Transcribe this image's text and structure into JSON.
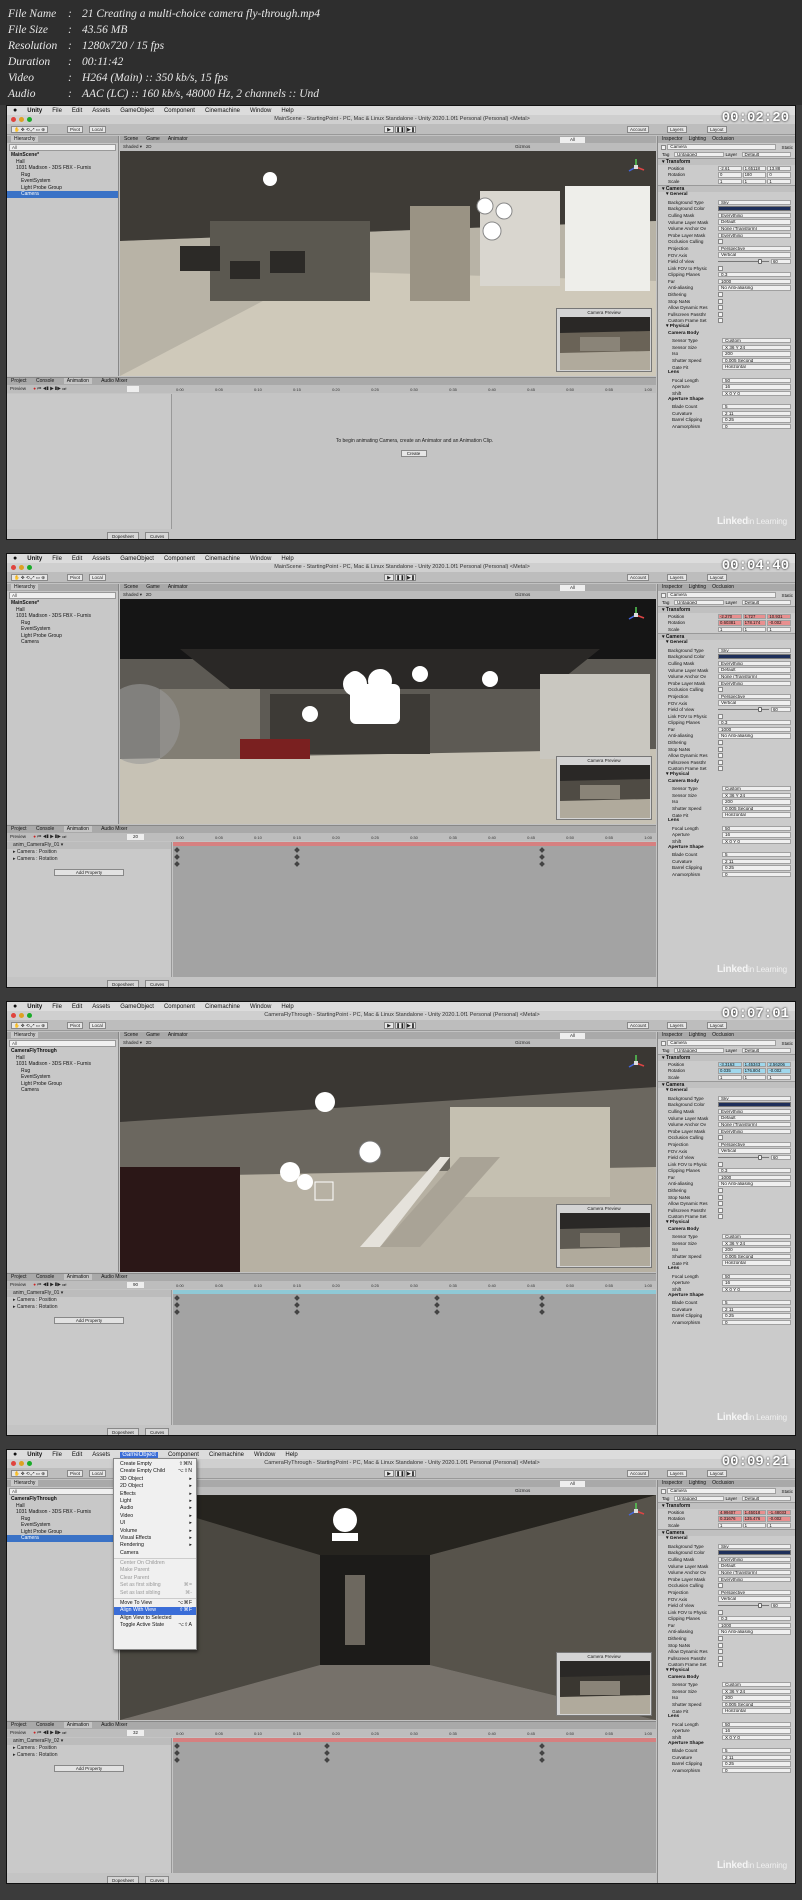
{
  "header": {
    "rows": [
      {
        "key": "File Name",
        "value": "21 Creating a multi-choice camera fly-through.mp4"
      },
      {
        "key": "File Size",
        "value": "43.56 MB"
      },
      {
        "key": "Resolution",
        "value": "1280x720 / 15 fps"
      },
      {
        "key": "Duration",
        "value": "00:11:42"
      },
      {
        "key": "Video",
        "value": "H264 (Main) :: 350 kb/s, 15 fps"
      },
      {
        "key": "Audio",
        "value": "AAC (LC) :: 160 kb/s, 48000 Hz, 2 channels :: Und"
      }
    ]
  },
  "common": {
    "menu": [
      "Unity",
      "File",
      "Edit",
      "Assets",
      "GameObject",
      "Component",
      "Cinemachine",
      "Window",
      "Help"
    ],
    "toolbar": {
      "pivot": "Pivot",
      "local": "Local",
      "collab": "Collab",
      "account": "Account",
      "layers": "Layers",
      "layout": "Layout"
    },
    "panels": {
      "hierarchy": "Hierarchy",
      "scene": "Scene",
      "game": "Game",
      "animator": "Animator",
      "inspector": "Inspector",
      "lighting": "Lighting",
      "occlusion": "Occlusion",
      "project": "Project",
      "console": "Console",
      "animation": "Animation",
      "audio_mixer": "Audio Mixer",
      "camera_preview": "Camera Preview"
    },
    "scene_toolbar": {
      "shading": "Shaded",
      "mode": "2D",
      "gizmos": "Gizmos",
      "search": "All"
    },
    "anim_toolbar": {
      "preview": "Preview",
      "add_property": "Add Property",
      "dopesheet": "Dopesheet",
      "curves": "Curves"
    },
    "inspector": {
      "object": "Camera",
      "static": "Static",
      "tag_label": "Tag",
      "tag": "Untagged",
      "layer_label": "Layer",
      "layer": "Default",
      "transform": "Transform",
      "position": "Position",
      "rotation": "Rotation",
      "scale": "Scale",
      "camera": "Camera",
      "general": "General",
      "rows": [
        {
          "label": "Background Type",
          "value": "Sky"
        },
        {
          "label": "Background Color",
          "value": ""
        },
        {
          "label": "Culling Mask",
          "value": "Everything"
        },
        {
          "label": "Volume Layer Mask",
          "value": "Default"
        },
        {
          "label": "Volume Anchor Ov",
          "value": "None (Transform)"
        },
        {
          "label": "Probe Layer Mask",
          "value": "Everything"
        },
        {
          "label": "Occlusion Culling",
          "value": ""
        },
        {
          "label": "Projection",
          "value": "Perspective"
        },
        {
          "label": "FOV Axis",
          "value": "Vertical"
        },
        {
          "label": "Field of View",
          "value": "60"
        },
        {
          "label": "Link FOV to Physic",
          "value": ""
        },
        {
          "label": "Clipping Planes",
          "value": "0.3"
        },
        {
          "label": "Far",
          "value": "1000"
        },
        {
          "label": "Anti-aliasing",
          "value": "No Anti-aliasing"
        },
        {
          "label": "Dithering",
          "value": ""
        },
        {
          "label": "Stop NaNs",
          "value": ""
        },
        {
          "label": "Allow Dynamic Res",
          "value": ""
        },
        {
          "label": "Fullscreen Passthr",
          "value": ""
        },
        {
          "label": "Custom Frame Set",
          "value": ""
        }
      ],
      "near_label": "Near",
      "far_label": "Far",
      "physical": "Physical",
      "camera_body": "Camera Body",
      "body_rows": [
        {
          "label": "Sensor Type",
          "value": "Custom"
        },
        {
          "label": "Sensor Size",
          "value": "X 36   Y 24"
        },
        {
          "label": "Iso",
          "value": "200"
        },
        {
          "label": "Shutter Speed",
          "value": "0.005   Second"
        },
        {
          "label": "Gate Fit",
          "value": "Horizontal"
        }
      ],
      "lens": "Lens",
      "lens_rows": [
        {
          "label": "Focal Length",
          "value": "50"
        },
        {
          "label": "Aperture",
          "value": "16"
        },
        {
          "label": "Shift",
          "value": "X 0   Y 0"
        }
      ],
      "aperture_shape": "Aperture Shape",
      "shape_rows": [
        {
          "label": "Blade Count",
          "value": "5"
        },
        {
          "label": "Curvature",
          "value": "2          11"
        },
        {
          "label": "Barrel Clipping",
          "value": "0.25"
        },
        {
          "label": "Anamorphism",
          "value": "0"
        }
      ]
    },
    "watermark": {
      "brand": "Linked",
      "suffix": "in Learning"
    }
  },
  "frames": [
    {
      "timestamp": "00:02:20",
      "title": "MainScene - StartingPoint - PC, Mac & Linux Standalone - Unity 2020.1.0f1 Personal (Personal) <Metal>",
      "hierarchy": [
        {
          "label": "MainScene*",
          "indent": 0,
          "selected": false,
          "bold": true
        },
        {
          "label": "Hall",
          "indent": 1,
          "selected": false
        },
        {
          "label": "1031 Madison - 3DS FBX - Furnis",
          "indent": 1,
          "selected": false
        },
        {
          "label": "Rug",
          "indent": 2,
          "selected": false
        },
        {
          "label": "EventSystem",
          "indent": 2,
          "selected": false
        },
        {
          "label": "Light Probe Group",
          "indent": 2,
          "selected": false
        },
        {
          "label": "Camera",
          "indent": 2,
          "selected": true
        }
      ],
      "position": [
        "-2.61",
        "1.65118",
        "13.88"
      ],
      "rotation": [
        "0",
        "180",
        "0"
      ],
      "scale": [
        "1",
        "1",
        "1"
      ],
      "pos_style": "plain",
      "anim_message": "To begin animating Camera, create an Animator and an Animation Clip.",
      "anim_create": "Create",
      "clip": "",
      "anim_props": [],
      "frame_field": "",
      "ruler": [
        "0:00",
        "0:05",
        "0:10",
        "0:15",
        "0:20",
        "0:25",
        "0:30",
        "0:35",
        "0:40",
        "0:45",
        "0:50",
        "0:55",
        "1:00"
      ],
      "menu_open": false
    },
    {
      "timestamp": "00:04:40",
      "title": "MainScene - StartingPoint - PC, Mac & Linux Standalone - Unity 2020.1.0f1 Personal (Personal) <Metal>",
      "hierarchy": [
        {
          "label": "MainScene*",
          "indent": 0,
          "selected": false,
          "bold": true
        },
        {
          "label": "Hall",
          "indent": 1,
          "selected": false
        },
        {
          "label": "1031 Madison - 3DS FBX - Furnis",
          "indent": 1,
          "selected": false
        },
        {
          "label": "Rug",
          "indent": 2,
          "selected": false
        },
        {
          "label": "EventSystem",
          "indent": 2,
          "selected": false
        },
        {
          "label": "Light Probe Group",
          "indent": 2,
          "selected": false
        },
        {
          "label": "Camera",
          "indent": 2,
          "selected": false
        }
      ],
      "position": [
        "-2.270",
        "1.727",
        "10.931"
      ],
      "rotation": [
        "0.60381",
        "178.174",
        "-0.002"
      ],
      "scale": [
        "1",
        "1",
        "1"
      ],
      "pos_style": "red",
      "anim_message": "",
      "anim_create": "",
      "clip": "anim_CameraFly_01",
      "anim_props": [
        "Camera : Position",
        "Camera : Rotation"
      ],
      "frame_field": "20",
      "ruler": [
        "0:00",
        "0:05",
        "0:10",
        "0:15",
        "0:20",
        "0:25",
        "0:30",
        "0:35",
        "0:40",
        "0:45",
        "0:50",
        "0:55",
        "1:00"
      ],
      "menu_open": false
    },
    {
      "timestamp": "00:07:01",
      "title": "CameraFlyThrough - StartingPoint - PC, Mac & Linux Standalone - Unity 2020.1.0f1 Personal (Personal) <Metal>",
      "hierarchy": [
        {
          "label": "CameraFlyThrough",
          "indent": 0,
          "selected": false,
          "bold": true
        },
        {
          "label": "Hall",
          "indent": 1,
          "selected": false
        },
        {
          "label": "1031 Madison - 3DS FBX - Furnis",
          "indent": 1,
          "selected": false
        },
        {
          "label": "Rug",
          "indent": 2,
          "selected": false
        },
        {
          "label": "EventSystem",
          "indent": 2,
          "selected": false
        },
        {
          "label": "Light Probe Group",
          "indent": 2,
          "selected": false
        },
        {
          "label": "Camera",
          "indent": 2,
          "selected": false
        }
      ],
      "position": [
        "-3.3163",
        "1.45343",
        "2.56206"
      ],
      "rotation": [
        "0.035",
        "176.804",
        "-0.002"
      ],
      "scale": [
        "1",
        "1",
        "1"
      ],
      "pos_style": "cyan",
      "anim_message": "",
      "anim_create": "",
      "clip": "anim_CameraFly_01",
      "anim_props": [
        "Camera : Position",
        "Camera : Rotation"
      ],
      "frame_field": "90",
      "ruler": [
        "0:00",
        "0:05",
        "0:10",
        "0:15",
        "0:20",
        "0:25",
        "0:30",
        "0:35",
        "0:40",
        "0:45",
        "0:50",
        "0:55",
        "1:00"
      ],
      "menu_open": false
    },
    {
      "timestamp": "00:09:21",
      "title": "CameraFlyThrough - StartingPoint - PC, Mac & Linux Standalone - Unity 2020.1.0f1 Personal (Personal) <Metal>",
      "hierarchy": [
        {
          "label": "CameraFlyThrough",
          "indent": 0,
          "selected": false,
          "bold": true
        },
        {
          "label": "Hall",
          "indent": 1,
          "selected": false
        },
        {
          "label": "1031 Madison - 3DS FBX - Furnis",
          "indent": 1,
          "selected": false
        },
        {
          "label": "Rug",
          "indent": 2,
          "selected": false
        },
        {
          "label": "EventSystem",
          "indent": 2,
          "selected": false
        },
        {
          "label": "Light Probe Group",
          "indent": 2,
          "selected": false
        },
        {
          "label": "Camera",
          "indent": 2,
          "selected": true
        }
      ],
      "position": [
        "4.99407",
        "1.45018",
        "-1.48033"
      ],
      "rotation": [
        "0.31676",
        "135.476",
        "-0.002"
      ],
      "scale": [
        "1",
        "1",
        "1"
      ],
      "pos_style": "red",
      "anim_message": "",
      "anim_create": "",
      "clip": "anim_CameraFly_02",
      "anim_props": [
        "Camera : Position",
        "Camera : Rotation"
      ],
      "frame_field": "32",
      "ruler": [
        "0:00",
        "0:05",
        "0:10",
        "0:15",
        "0:20",
        "0:25",
        "0:30",
        "0:35",
        "0:40",
        "0:45",
        "0:50",
        "0:55",
        "1:00"
      ],
      "menu_open": true
    }
  ],
  "gameobject_menu": [
    {
      "label": "Create Empty",
      "shortcut": "⇧⌘N",
      "disabled": false
    },
    {
      "label": "Create Empty Child",
      "shortcut": "⌥⇧N",
      "disabled": false
    },
    {
      "label": "3D Object",
      "shortcut": "▸",
      "disabled": false
    },
    {
      "label": "2D Object",
      "shortcut": "▸",
      "disabled": false
    },
    {
      "label": "Effects",
      "shortcut": "▸",
      "disabled": false
    },
    {
      "label": "Light",
      "shortcut": "▸",
      "disabled": false
    },
    {
      "label": "Audio",
      "shortcut": "▸",
      "disabled": false
    },
    {
      "label": "Video",
      "shortcut": "▸",
      "disabled": false
    },
    {
      "label": "UI",
      "shortcut": "▸",
      "disabled": false
    },
    {
      "label": "Volume",
      "shortcut": "▸",
      "disabled": false
    },
    {
      "label": "Visual Effects",
      "shortcut": "▸",
      "disabled": false
    },
    {
      "label": "Rendering",
      "shortcut": "▸",
      "disabled": false
    },
    {
      "label": "Camera",
      "shortcut": "",
      "disabled": false
    },
    {
      "label": "Center On Children",
      "shortcut": "",
      "disabled": true
    },
    {
      "label": "Make Parent",
      "shortcut": "",
      "disabled": true
    },
    {
      "label": "Clear Parent",
      "shortcut": "",
      "disabled": true
    },
    {
      "label": "Set as first sibling",
      "shortcut": "⌘=",
      "disabled": true
    },
    {
      "label": "Set as last sibling",
      "shortcut": "⌘-",
      "disabled": true
    },
    {
      "label": "Move To View",
      "shortcut": "⌥⌘F",
      "disabled": false
    },
    {
      "label": "Align With View",
      "shortcut": "⇧⌘F",
      "disabled": false,
      "highlighted": true
    },
    {
      "label": "Align View to Selected",
      "shortcut": "",
      "disabled": false
    },
    {
      "label": "Toggle Active State",
      "shortcut": "⌥⇧A",
      "disabled": false
    }
  ]
}
